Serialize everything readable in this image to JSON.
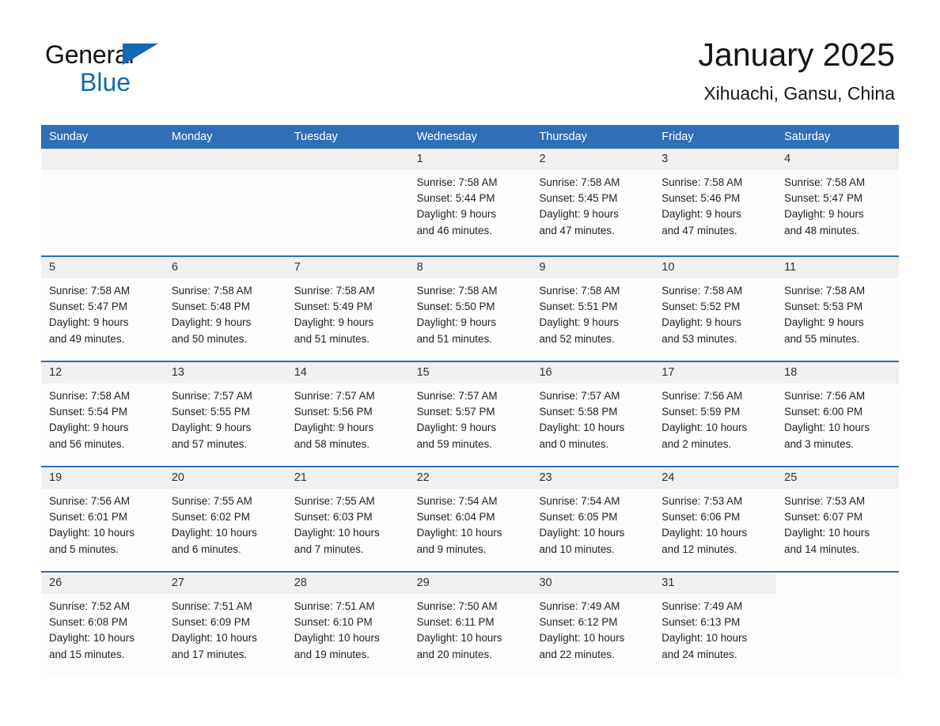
{
  "brand": {
    "word1": "General",
    "word2": "Blue",
    "triangle_color": "#1268b3"
  },
  "header": {
    "title": "January 2025",
    "location": "Xihuachi, Gansu, China"
  },
  "theme": {
    "header_blue": "#2e6fb7",
    "day_band_gray": "#f0f0f0",
    "text": "#222222"
  },
  "weekdays": [
    "Sunday",
    "Monday",
    "Tuesday",
    "Wednesday",
    "Thursday",
    "Friday",
    "Saturday"
  ],
  "weeks": [
    [
      {
        "day": "",
        "lines": []
      },
      {
        "day": "",
        "lines": []
      },
      {
        "day": "",
        "lines": []
      },
      {
        "day": "1",
        "lines": [
          "Sunrise: 7:58 AM",
          "Sunset: 5:44 PM",
          "Daylight: 9 hours",
          "and 46 minutes."
        ]
      },
      {
        "day": "2",
        "lines": [
          "Sunrise: 7:58 AM",
          "Sunset: 5:45 PM",
          "Daylight: 9 hours",
          "and 47 minutes."
        ]
      },
      {
        "day": "3",
        "lines": [
          "Sunrise: 7:58 AM",
          "Sunset: 5:46 PM",
          "Daylight: 9 hours",
          "and 47 minutes."
        ]
      },
      {
        "day": "4",
        "lines": [
          "Sunrise: 7:58 AM",
          "Sunset: 5:47 PM",
          "Daylight: 9 hours",
          "and 48 minutes."
        ]
      }
    ],
    [
      {
        "day": "5",
        "lines": [
          "Sunrise: 7:58 AM",
          "Sunset: 5:47 PM",
          "Daylight: 9 hours",
          "and 49 minutes."
        ]
      },
      {
        "day": "6",
        "lines": [
          "Sunrise: 7:58 AM",
          "Sunset: 5:48 PM",
          "Daylight: 9 hours",
          "and 50 minutes."
        ]
      },
      {
        "day": "7",
        "lines": [
          "Sunrise: 7:58 AM",
          "Sunset: 5:49 PM",
          "Daylight: 9 hours",
          "and 51 minutes."
        ]
      },
      {
        "day": "8",
        "lines": [
          "Sunrise: 7:58 AM",
          "Sunset: 5:50 PM",
          "Daylight: 9 hours",
          "and 51 minutes."
        ]
      },
      {
        "day": "9",
        "lines": [
          "Sunrise: 7:58 AM",
          "Sunset: 5:51 PM",
          "Daylight: 9 hours",
          "and 52 minutes."
        ]
      },
      {
        "day": "10",
        "lines": [
          "Sunrise: 7:58 AM",
          "Sunset: 5:52 PM",
          "Daylight: 9 hours",
          "and 53 minutes."
        ]
      },
      {
        "day": "11",
        "lines": [
          "Sunrise: 7:58 AM",
          "Sunset: 5:53 PM",
          "Daylight: 9 hours",
          "and 55 minutes."
        ]
      }
    ],
    [
      {
        "day": "12",
        "lines": [
          "Sunrise: 7:58 AM",
          "Sunset: 5:54 PM",
          "Daylight: 9 hours",
          "and 56 minutes."
        ]
      },
      {
        "day": "13",
        "lines": [
          "Sunrise: 7:57 AM",
          "Sunset: 5:55 PM",
          "Daylight: 9 hours",
          "and 57 minutes."
        ]
      },
      {
        "day": "14",
        "lines": [
          "Sunrise: 7:57 AM",
          "Sunset: 5:56 PM",
          "Daylight: 9 hours",
          "and 58 minutes."
        ]
      },
      {
        "day": "15",
        "lines": [
          "Sunrise: 7:57 AM",
          "Sunset: 5:57 PM",
          "Daylight: 9 hours",
          "and 59 minutes."
        ]
      },
      {
        "day": "16",
        "lines": [
          "Sunrise: 7:57 AM",
          "Sunset: 5:58 PM",
          "Daylight: 10 hours",
          "and 0 minutes."
        ]
      },
      {
        "day": "17",
        "lines": [
          "Sunrise: 7:56 AM",
          "Sunset: 5:59 PM",
          "Daylight: 10 hours",
          "and 2 minutes."
        ]
      },
      {
        "day": "18",
        "lines": [
          "Sunrise: 7:56 AM",
          "Sunset: 6:00 PM",
          "Daylight: 10 hours",
          "and 3 minutes."
        ]
      }
    ],
    [
      {
        "day": "19",
        "lines": [
          "Sunrise: 7:56 AM",
          "Sunset: 6:01 PM",
          "Daylight: 10 hours",
          "and 5 minutes."
        ]
      },
      {
        "day": "20",
        "lines": [
          "Sunrise: 7:55 AM",
          "Sunset: 6:02 PM",
          "Daylight: 10 hours",
          "and 6 minutes."
        ]
      },
      {
        "day": "21",
        "lines": [
          "Sunrise: 7:55 AM",
          "Sunset: 6:03 PM",
          "Daylight: 10 hours",
          "and 7 minutes."
        ]
      },
      {
        "day": "22",
        "lines": [
          "Sunrise: 7:54 AM",
          "Sunset: 6:04 PM",
          "Daylight: 10 hours",
          "and 9 minutes."
        ]
      },
      {
        "day": "23",
        "lines": [
          "Sunrise: 7:54 AM",
          "Sunset: 6:05 PM",
          "Daylight: 10 hours",
          "and 10 minutes."
        ]
      },
      {
        "day": "24",
        "lines": [
          "Sunrise: 7:53 AM",
          "Sunset: 6:06 PM",
          "Daylight: 10 hours",
          "and 12 minutes."
        ]
      },
      {
        "day": "25",
        "lines": [
          "Sunrise: 7:53 AM",
          "Sunset: 6:07 PM",
          "Daylight: 10 hours",
          "and 14 minutes."
        ]
      }
    ],
    [
      {
        "day": "26",
        "lines": [
          "Sunrise: 7:52 AM",
          "Sunset: 6:08 PM",
          "Daylight: 10 hours",
          "and 15 minutes."
        ]
      },
      {
        "day": "27",
        "lines": [
          "Sunrise: 7:51 AM",
          "Sunset: 6:09 PM",
          "Daylight: 10 hours",
          "and 17 minutes."
        ]
      },
      {
        "day": "28",
        "lines": [
          "Sunrise: 7:51 AM",
          "Sunset: 6:10 PM",
          "Daylight: 10 hours",
          "and 19 minutes."
        ]
      },
      {
        "day": "29",
        "lines": [
          "Sunrise: 7:50 AM",
          "Sunset: 6:11 PM",
          "Daylight: 10 hours",
          "and 20 minutes."
        ]
      },
      {
        "day": "30",
        "lines": [
          "Sunrise: 7:49 AM",
          "Sunset: 6:12 PM",
          "Daylight: 10 hours",
          "and 22 minutes."
        ]
      },
      {
        "day": "31",
        "lines": [
          "Sunrise: 7:49 AM",
          "Sunset: 6:13 PM",
          "Daylight: 10 hours",
          "and 24 minutes."
        ]
      },
      {
        "day": "",
        "lines": []
      }
    ]
  ]
}
